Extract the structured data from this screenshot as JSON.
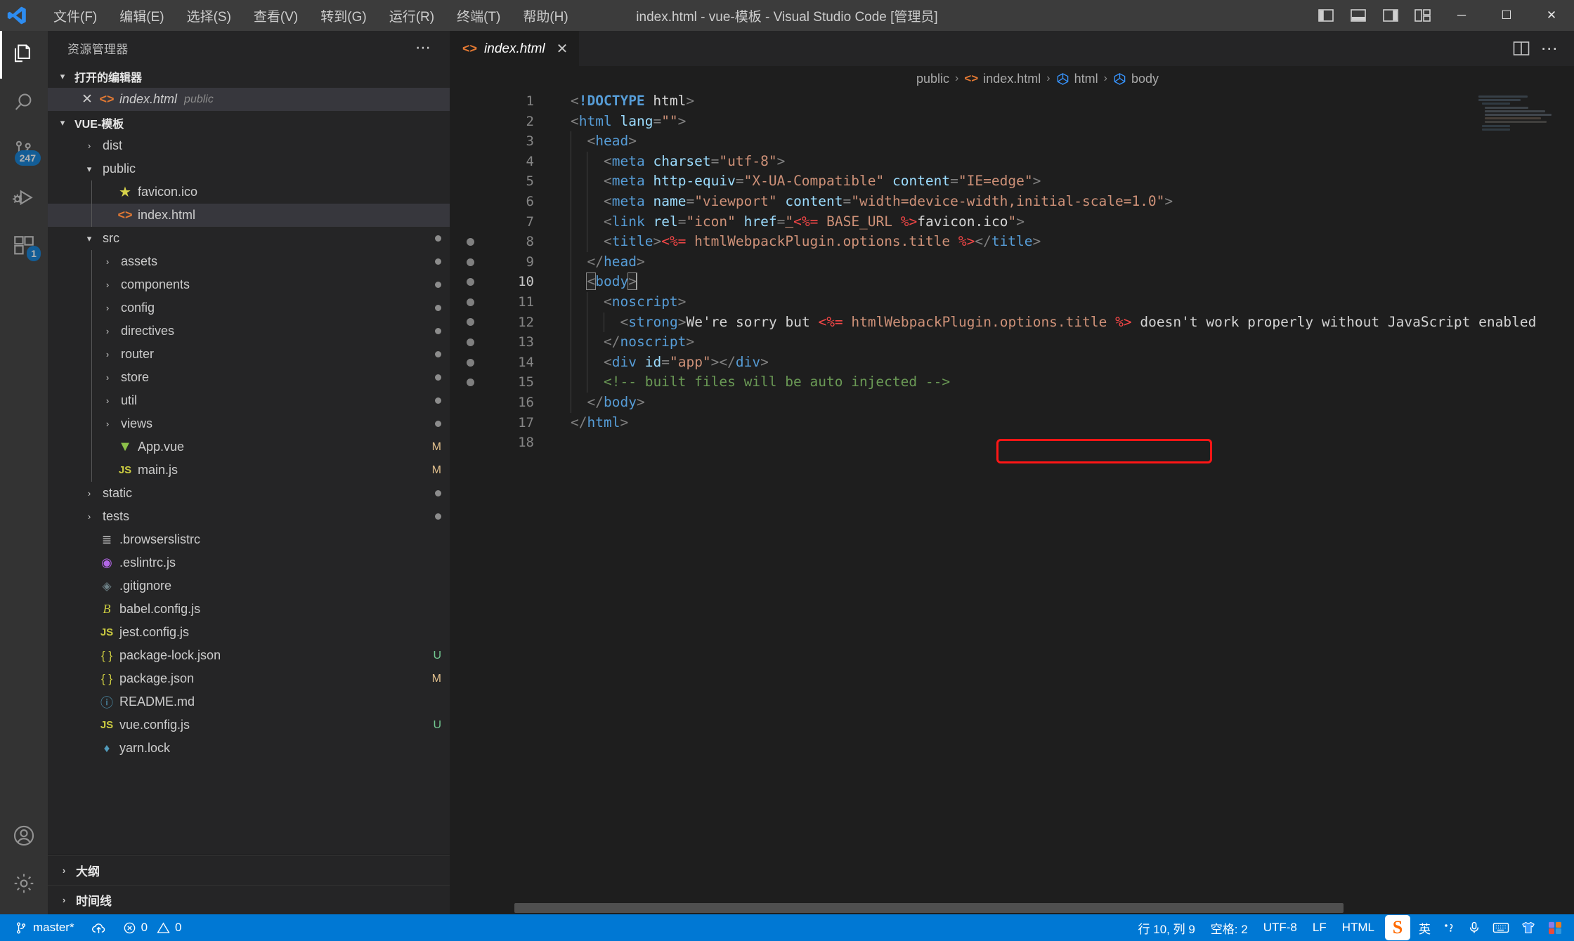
{
  "window": {
    "title": "index.html - vue-模板 - Visual Studio Code [管理员]",
    "minimize": "─",
    "maximize": "☐",
    "close": "✕"
  },
  "menu": [
    {
      "label": "文件(F)",
      "name": "menu-file"
    },
    {
      "label": "编辑(E)",
      "name": "menu-edit"
    },
    {
      "label": "选择(S)",
      "name": "menu-selection"
    },
    {
      "label": "查看(V)",
      "name": "menu-view"
    },
    {
      "label": "转到(G)",
      "name": "menu-go"
    },
    {
      "label": "运行(R)",
      "name": "menu-run"
    },
    {
      "label": "终端(T)",
      "name": "menu-terminal"
    },
    {
      "label": "帮助(H)",
      "name": "menu-help"
    }
  ],
  "activitybar": [
    {
      "icon": "explorer-icon",
      "badge": "",
      "active": true
    },
    {
      "icon": "search-icon",
      "badge": "",
      "active": false
    },
    {
      "icon": "source-control-icon",
      "badge": "247",
      "active": false
    },
    {
      "icon": "run-debug-icon",
      "badge": "",
      "active": false
    },
    {
      "icon": "extensions-icon",
      "badge": "1",
      "active": false
    },
    {
      "icon": "accounts-icon",
      "badge": "",
      "active": false
    },
    {
      "icon": "settings-gear-icon",
      "badge": "",
      "active": false
    }
  ],
  "sidebar": {
    "title": "资源管理器",
    "more_actions": "⋯",
    "open_editors": {
      "label": "打开的编辑器",
      "items": [
        {
          "close": "✕",
          "icon": "html-file-icon",
          "label": "index.html",
          "sub": "public",
          "selected": true
        }
      ]
    },
    "workspace": {
      "label": "VUE-模板",
      "items": [
        {
          "depth": 1,
          "twisty": "›",
          "icon": "folder-icon",
          "label": "dist",
          "right": "",
          "right_type": ""
        },
        {
          "depth": 1,
          "twisty": "⌄",
          "icon": "folder-icon",
          "label": "public",
          "right": "",
          "right_type": ""
        },
        {
          "depth": 2,
          "twisty": "",
          "icon": "star-icon",
          "label": "favicon.ico",
          "right": "",
          "right_type": ""
        },
        {
          "depth": 2,
          "twisty": "",
          "icon": "html-file-icon",
          "label": "index.html",
          "right": "",
          "right_type": "",
          "selected": true
        },
        {
          "depth": 1,
          "twisty": "⌄",
          "icon": "folder-icon",
          "label": "src",
          "right": "●",
          "right_type": "dot"
        },
        {
          "depth": 2,
          "twisty": "›",
          "icon": "folder-icon",
          "label": "assets",
          "right": "●",
          "right_type": "dot"
        },
        {
          "depth": 2,
          "twisty": "›",
          "icon": "folder-icon",
          "label": "components",
          "right": "●",
          "right_type": "dot"
        },
        {
          "depth": 2,
          "twisty": "›",
          "icon": "folder-icon",
          "label": "config",
          "right": "●",
          "right_type": "dot"
        },
        {
          "depth": 2,
          "twisty": "›",
          "icon": "folder-icon",
          "label": "directives",
          "right": "●",
          "right_type": "dot"
        },
        {
          "depth": 2,
          "twisty": "›",
          "icon": "folder-icon",
          "label": "router",
          "right": "●",
          "right_type": "dot"
        },
        {
          "depth": 2,
          "twisty": "›",
          "icon": "folder-icon",
          "label": "store",
          "right": "●",
          "right_type": "dot"
        },
        {
          "depth": 2,
          "twisty": "›",
          "icon": "folder-icon",
          "label": "util",
          "right": "●",
          "right_type": "dot"
        },
        {
          "depth": 2,
          "twisty": "›",
          "icon": "folder-icon",
          "label": "views",
          "right": "●",
          "right_type": "dot"
        },
        {
          "depth": 2,
          "twisty": "",
          "icon": "vue-file-icon",
          "label": "App.vue",
          "right": "M",
          "right_type": "m"
        },
        {
          "depth": 2,
          "twisty": "",
          "icon": "js-file-icon",
          "label": "main.js",
          "right": "M",
          "right_type": "m"
        },
        {
          "depth": 1,
          "twisty": "›",
          "icon": "folder-icon",
          "label": "static",
          "right": "●",
          "right_type": "dot"
        },
        {
          "depth": 1,
          "twisty": "›",
          "icon": "folder-icon",
          "label": "tests",
          "right": "●",
          "right_type": "dot"
        },
        {
          "depth": 1,
          "twisty": "",
          "icon": "list-file-icon",
          "label": ".browserslistrc",
          "right": "",
          "right_type": ""
        },
        {
          "depth": 1,
          "twisty": "",
          "icon": "eslint-file-icon",
          "label": ".eslintrc.js",
          "right": "",
          "right_type": ""
        },
        {
          "depth": 1,
          "twisty": "",
          "icon": "git-file-icon",
          "label": ".gitignore",
          "right": "",
          "right_type": ""
        },
        {
          "depth": 1,
          "twisty": "",
          "icon": "babel-file-icon",
          "label": "babel.config.js",
          "right": "",
          "right_type": ""
        },
        {
          "depth": 1,
          "twisty": "",
          "icon": "js-file-icon",
          "label": "jest.config.js",
          "right": "",
          "right_type": ""
        },
        {
          "depth": 1,
          "twisty": "",
          "icon": "json-file-icon",
          "label": "package-lock.json",
          "right": "U",
          "right_type": "u"
        },
        {
          "depth": 1,
          "twisty": "",
          "icon": "json-file-icon",
          "label": "package.json",
          "right": "M",
          "right_type": "m"
        },
        {
          "depth": 1,
          "twisty": "",
          "icon": "info-file-icon",
          "label": "README.md",
          "right": "",
          "right_type": ""
        },
        {
          "depth": 1,
          "twisty": "",
          "icon": "js-file-icon",
          "label": "vue.config.js",
          "right": "U",
          "right_type": "u"
        },
        {
          "depth": 1,
          "twisty": "",
          "icon": "yarn-file-icon",
          "label": "yarn.lock",
          "right": "",
          "right_type": ""
        }
      ]
    },
    "outline": {
      "label": "大纲",
      "twisty": "›"
    },
    "timeline": {
      "label": "时间线",
      "twisty": "›"
    }
  },
  "editor": {
    "tab": {
      "label": "index.html",
      "icon": "html-file-icon",
      "close": "✕"
    },
    "actions": [
      {
        "icon": "split-editor-icon"
      },
      {
        "icon": "more-actions-icon",
        "label": "⋯"
      }
    ],
    "breadcrumbs": [
      {
        "label": "public",
        "icon": ""
      },
      {
        "label": "index.html",
        "icon": "html-file-icon"
      },
      {
        "label": "html",
        "icon": "symbol-field-icon"
      },
      {
        "label": "body",
        "icon": "symbol-field-icon"
      }
    ],
    "breadcrumb_separator": "›",
    "lines": [
      {
        "n": "1",
        "fold": false
      },
      {
        "n": "2",
        "fold": false
      },
      {
        "n": "3",
        "fold": false
      },
      {
        "n": "4",
        "fold": false
      },
      {
        "n": "5",
        "fold": false
      },
      {
        "n": "6",
        "fold": false
      },
      {
        "n": "7",
        "fold": false
      },
      {
        "n": "8",
        "fold": true
      },
      {
        "n": "9",
        "fold": true
      },
      {
        "n": "10",
        "fold": true,
        "current": true
      },
      {
        "n": "11",
        "fold": true
      },
      {
        "n": "12",
        "fold": true
      },
      {
        "n": "13",
        "fold": true
      },
      {
        "n": "14",
        "fold": true
      },
      {
        "n": "15",
        "fold": true
      },
      {
        "n": "16",
        "fold": false
      },
      {
        "n": "17",
        "fold": false
      },
      {
        "n": "18",
        "fold": false
      }
    ],
    "source_text": [
      "<!DOCTYPE html>",
      "<html lang=\"\">",
      "  <head>",
      "    <meta charset=\"utf-8\">",
      "    <meta http-equiv=\"X-UA-Compatible\" content=\"IE=edge\">",
      "    <meta name=\"viewport\" content=\"width=device-width,initial-scale=1.0\">",
      "    <link rel=\"icon\" href=\"<%= BASE_URL %>favicon.ico\">",
      "    <title><%= htmlWebpackPlugin.options.title %></title>",
      "  </head>",
      "  <body>",
      "    <noscript>",
      "      <strong>We're sorry but <%= htmlWebpackPlugin.options.title %> doesn't work properly without JavaScript enabled",
      "    </noscript>",
      "    <div id=\"app\"></div>",
      "    <!-- built files will be auto injected -->",
      "  </body>",
      "</html>",
      ""
    ]
  },
  "statusbar": {
    "left": [
      {
        "name": "remote-branch",
        "icon": "source-control-branch-icon",
        "label": "master*"
      },
      {
        "name": "sync-changes",
        "icon": "sync-cloud-icon",
        "label": ""
      },
      {
        "name": "problems",
        "icon": "error-warning-icon",
        "label": "0  0",
        "errors": "0",
        "warnings": "0"
      }
    ],
    "right": [
      {
        "name": "cursor-position",
        "label": "行 10, 列 9"
      },
      {
        "name": "indentation",
        "label": "空格: 2"
      },
      {
        "name": "encoding",
        "label": "UTF-8"
      },
      {
        "name": "eol",
        "label": "LF"
      },
      {
        "name": "language-mode",
        "label": "HTML"
      }
    ],
    "ime": {
      "logo": "S",
      "mode": "英",
      "items": [
        "punctuation-icon",
        "microphone-icon",
        "keyboard-icon",
        "skin-icon",
        "toolbox-icon"
      ]
    }
  },
  "colors": {
    "accent": "#0078d4",
    "annotation": "#ff1616",
    "titlebar_bg": "#3c3c3c",
    "sidebar_bg": "#252526",
    "editor_bg": "#1e1e1e",
    "activitybar_bg": "#333333"
  }
}
